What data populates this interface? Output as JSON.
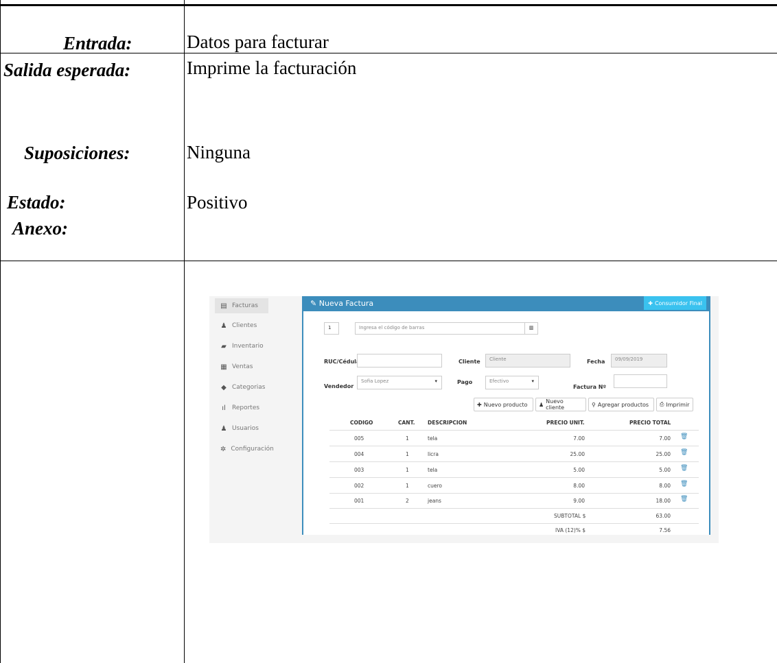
{
  "form": {
    "entrada_label": "Entrada:",
    "entrada_value": "Datos para facturar",
    "salida_label": "Salida esperada:",
    "salida_value": "Imprime la facturación",
    "suposiciones_label": "Suposiciones:",
    "suposiciones_value": "Ninguna",
    "estado_label": "Estado:",
    "estado_value": "Positivo",
    "anexo_label": "Anexo:"
  },
  "app": {
    "sidebar": [
      {
        "label": "Facturas",
        "icon": "invoice-icon"
      },
      {
        "label": "Clientes",
        "icon": "user-icon"
      },
      {
        "label": "Inventario",
        "icon": "folder-icon"
      },
      {
        "label": "Ventas",
        "icon": "table-icon"
      },
      {
        "label": "Categorias",
        "icon": "tag-icon"
      },
      {
        "label": "Reportes",
        "icon": "chart-icon"
      },
      {
        "label": "Usuarios",
        "icon": "user-icon"
      },
      {
        "label": "Configuración",
        "icon": "gear-icon"
      }
    ],
    "header_title": "Nueva Factura",
    "consumidor_button": "Consumidor Final",
    "qty_value": "1",
    "barcode_placeholder": "Ingresa el código de barras",
    "ruc_label": "RUC/Cédula",
    "cliente_label": "Cliente",
    "cliente_placeholder": "Cliente",
    "fecha_label": "Fecha",
    "fecha_value": "09/09/2019",
    "vendedor_label": "Vendedor",
    "vendedor_value": "Sofia Lopez",
    "pago_label": "Pago",
    "pago_value": "Efectivo",
    "factura_label": "Factura Nº",
    "buttons": {
      "nuevo_producto": "Nuevo producto",
      "nuevo_cliente": "Nuevo cliente",
      "agregar_productos": "Agregar productos",
      "imprimir": "Imprimir"
    },
    "table_headers": [
      "CODIGO",
      "CANT.",
      "DESCRIPCION",
      "PRECIO UNIT.",
      "PRECIO TOTAL"
    ],
    "rows": [
      {
        "codigo": "005",
        "cant": "1",
        "desc": "tela",
        "unit": "7.00",
        "total": "7.00"
      },
      {
        "codigo": "004",
        "cant": "1",
        "desc": "licra",
        "unit": "25.00",
        "total": "25.00"
      },
      {
        "codigo": "003",
        "cant": "1",
        "desc": "tela",
        "unit": "5.00",
        "total": "5.00"
      },
      {
        "codigo": "002",
        "cant": "1",
        "desc": "cuero",
        "unit": "8.00",
        "total": "8.00"
      },
      {
        "codigo": "001",
        "cant": "2",
        "desc": "jeans",
        "unit": "9.00",
        "total": "18.00"
      }
    ],
    "subtotal_label": "SUBTOTAL $",
    "subtotal_value": "63.00",
    "iva_label": "IVA (12)% $",
    "iva_value": "7.56",
    "accent_color": "#3c8dbc"
  }
}
